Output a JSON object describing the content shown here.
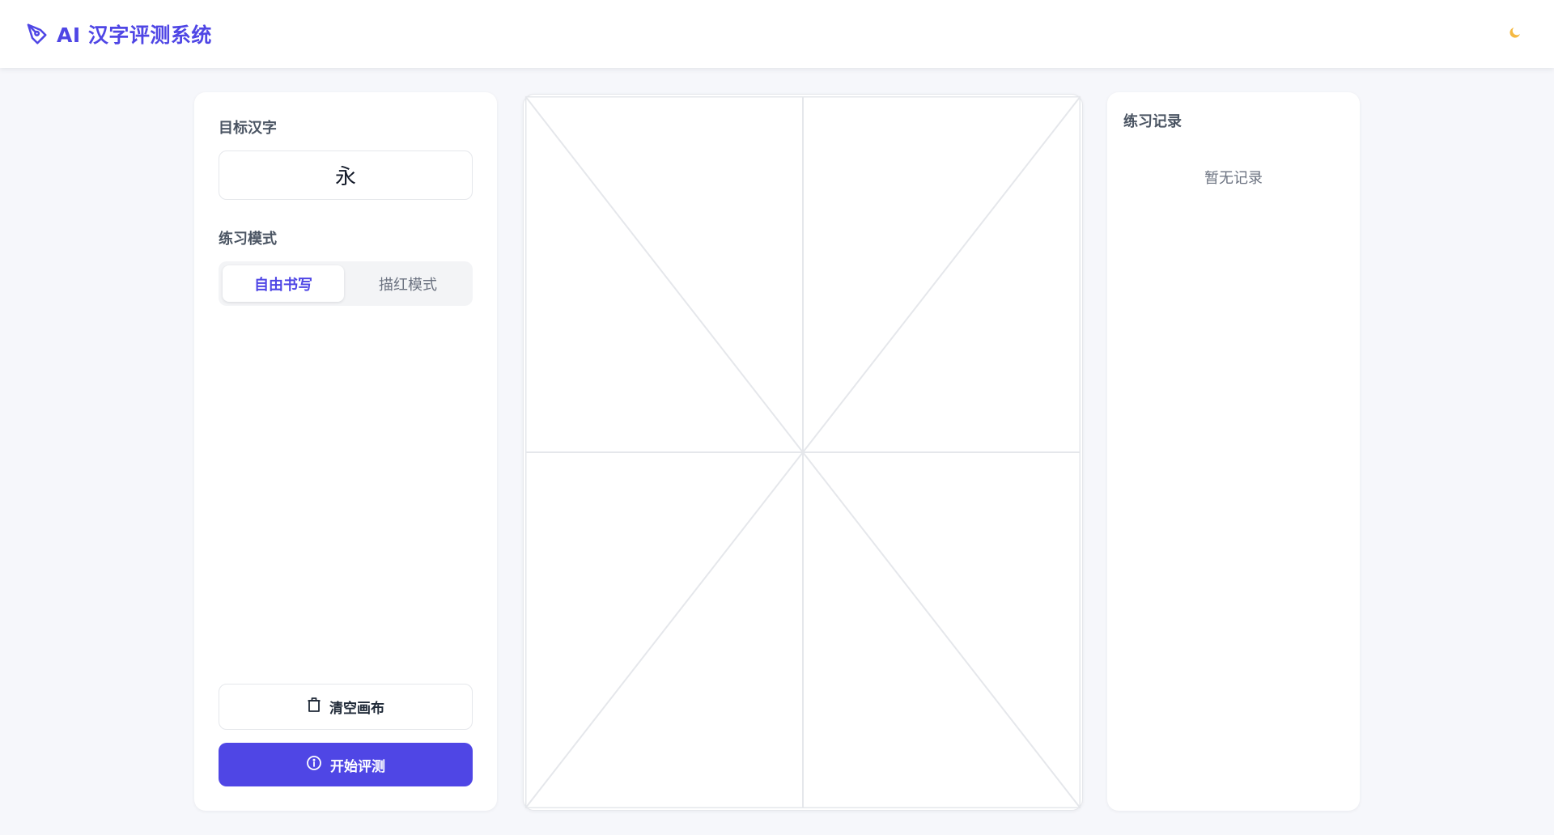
{
  "header": {
    "title": "AI 汉字评测系统",
    "brand_color": "#4f46e5",
    "logo_icon": "pen-nib-icon",
    "theme_icon": "moon-icon"
  },
  "left_panel": {
    "target_label": "目标汉字",
    "target_char": "永",
    "mode_label": "练习模式",
    "modes": [
      {
        "label": "自由书写",
        "active": true
      },
      {
        "label": "描红模式",
        "active": false
      }
    ],
    "clear_button": {
      "label": "清空画布",
      "icon": "trash-icon"
    },
    "start_button": {
      "label": "开始评测",
      "icon": "info-circle-icon"
    }
  },
  "canvas": {
    "grid": "米字格",
    "grid_color": "#e5e7eb"
  },
  "right_panel": {
    "title": "练习记录",
    "empty_text": "暂无记录"
  }
}
